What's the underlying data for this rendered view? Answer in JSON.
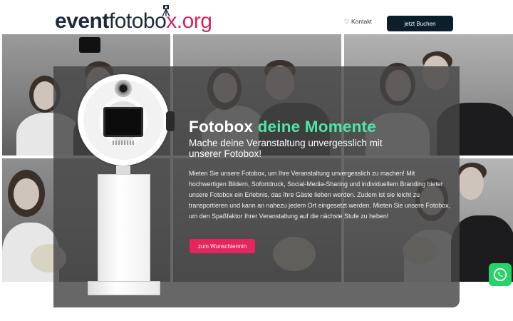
{
  "header": {
    "logo_part1": "event",
    "logo_part2": "fotobo",
    "logo_part3": "x.org",
    "nav_kontakt": "♡ Kontakt",
    "cta_buchen": "jetzt Buchen"
  },
  "hero": {
    "title_main": "Fotobox",
    "title_accent": "deine Momente",
    "subtitle": "Mache deine Veranstaltung unvergesslich mit unserer Fotobox!",
    "body": "Mieten Sie unsere Fotobox, um Ihre Veranstaltung unvergesslich zu machen! Mit hochwertigen Bildern, Sofortdruck, Social-Media-Sharing und individuellem Branding bietet unsere Fotobox ein Erlebnis, das Ihre Gäste lieben werden. Zudem ist sie leicht zu transportieren und kann an nahezu jedem Ort eingesetzt werden. Mieten Sie unsere Fotobox, um den Spaßfaktor Ihrer Veranstaltung auf die nächste Stufe zu heben!",
    "cta_label": "zum Wunschtermin"
  },
  "colors": {
    "accent_green": "#4ee6a8",
    "brand_pink": "#e6245e",
    "dark_navy": "#0b1e2b",
    "whatsapp_green": "#25d366"
  },
  "icons": {
    "logo_mark": "tripod-camera-icon",
    "whatsapp": "whatsapp-icon",
    "heart": "heart-icon"
  }
}
